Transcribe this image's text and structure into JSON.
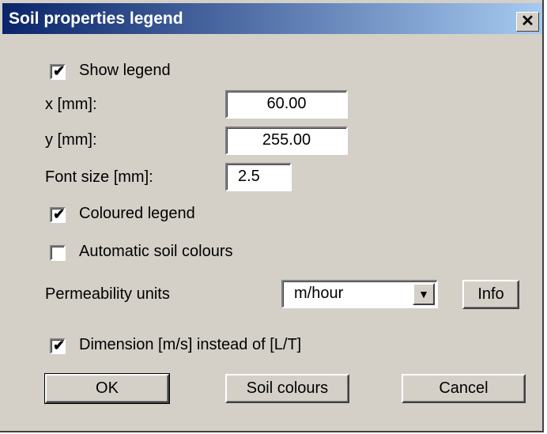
{
  "dialog": {
    "title": "Soil properties legend",
    "close_glyph": "✕"
  },
  "show_legend": {
    "label": "Show legend",
    "checked": true
  },
  "x_field": {
    "label": "x [mm]:",
    "value": "60.00"
  },
  "y_field": {
    "label": "y [mm]:",
    "value": "255.00"
  },
  "font_size_field": {
    "label": "Font size [mm]:",
    "value": "2.5"
  },
  "coloured_legend": {
    "label": "Coloured legend",
    "checked": true
  },
  "automatic_soil_colours": {
    "label": "Automatic soil colours",
    "checked": false
  },
  "permeability": {
    "label": "Permeability units",
    "selected": "m/hour",
    "info_label": "Info"
  },
  "dimension_option": {
    "label": "Dimension [m/s] instead of [L/T]",
    "checked": true
  },
  "buttons": {
    "ok": "OK",
    "soil_colours": "Soil colours",
    "cancel": "Cancel"
  },
  "check_glyph": "✔",
  "dropdown_glyph": "▼"
}
